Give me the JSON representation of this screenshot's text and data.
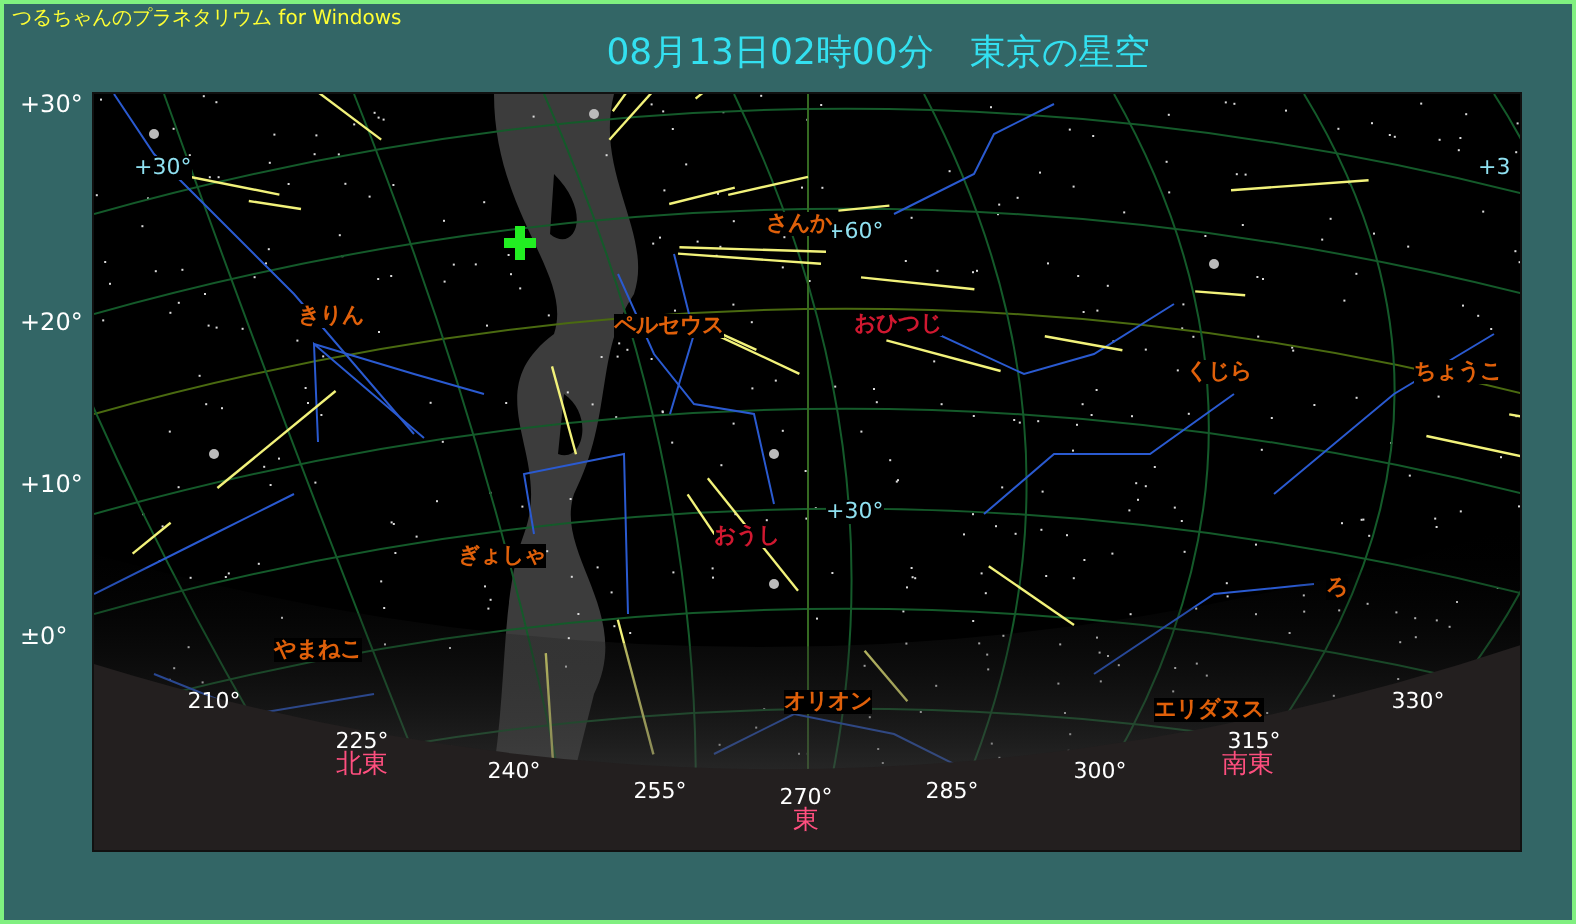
{
  "app_title": "つるちゃんのプラネタリウム for Windows",
  "title": "08月13日02時00分　東京の星空",
  "altitude_labels": [
    "+30°",
    "+20°",
    "+10°",
    "±0°"
  ],
  "sky_map": {
    "grid_labels": [
      "+30°",
      "+60°",
      "+30°",
      "+3"
    ],
    "constellations": [
      {
        "name": "きりん",
        "color": "#e0600a"
      },
      {
        "name": "ペルセウス",
        "color": "#e0600a"
      },
      {
        "name": "さんか",
        "color": "#e0600a"
      },
      {
        "name": "おひつじ",
        "color": "#d01830"
      },
      {
        "name": "おうし",
        "color": "#d01830"
      },
      {
        "name": "ぎょしゃ",
        "color": "#e0600a"
      },
      {
        "name": "やまねこ",
        "color": "#e0600a"
      },
      {
        "name": "くじら",
        "color": "#e0600a"
      },
      {
        "name": "ちょうこ",
        "color": "#e0600a"
      },
      {
        "name": "ろ",
        "color": "#e0600a"
      },
      {
        "name": "オリオン",
        "color": "#e0600a"
      },
      {
        "name": "エリダヌス",
        "color": "#e0600a"
      }
    ],
    "azimuth_labels": [
      "210°",
      "225°",
      "240°",
      "255°",
      "270°",
      "285°",
      "300°",
      "315°",
      "330°"
    ],
    "directions": [
      "北東",
      "東",
      "南東"
    ]
  }
}
